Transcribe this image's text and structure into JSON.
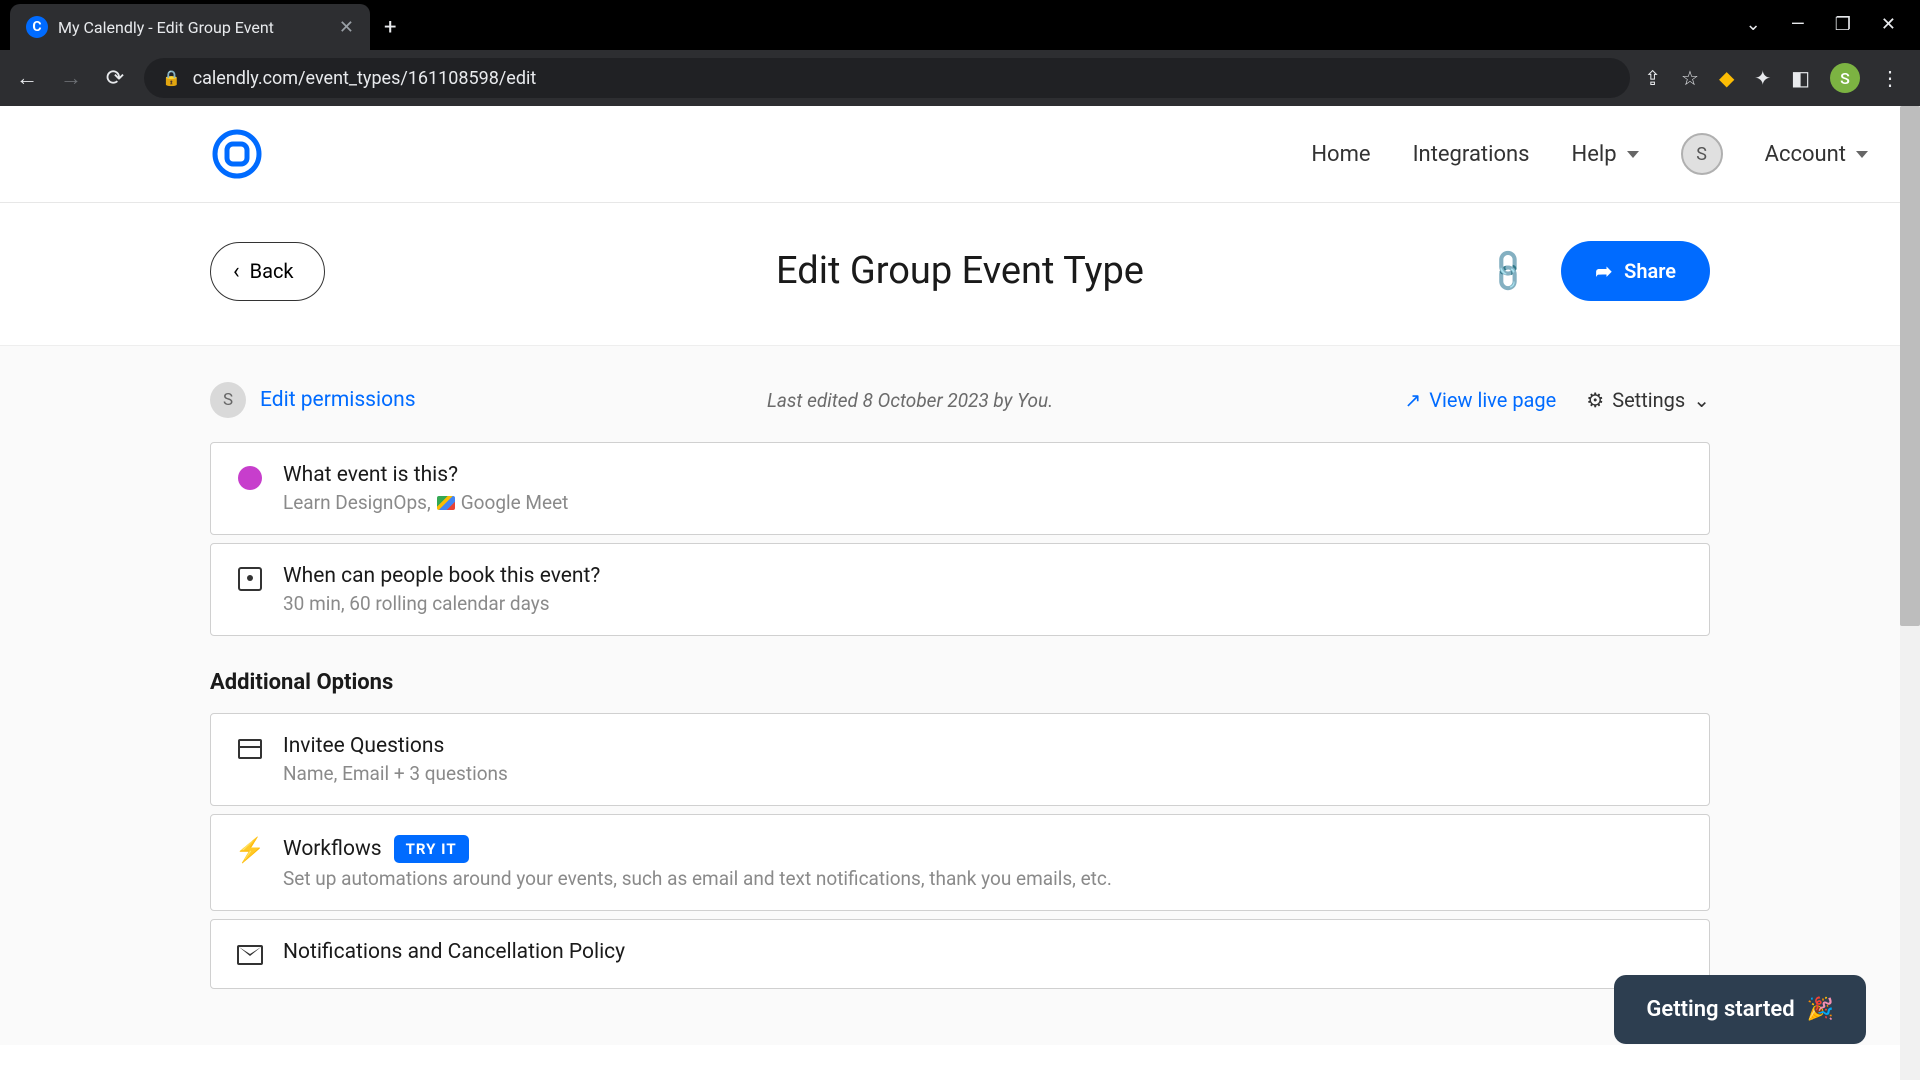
{
  "browser": {
    "tab_title": "My Calendly - Edit Group Event",
    "url": "calendly.com/event_types/161108598/edit",
    "profile_initial": "S"
  },
  "nav": {
    "home": "Home",
    "integrations": "Integrations",
    "help": "Help",
    "account": "Account",
    "avatar_initial": "S"
  },
  "header": {
    "back": "Back",
    "title": "Edit Group Event Type",
    "share": "Share"
  },
  "meta": {
    "avatar_initial": "S",
    "permissions": "Edit permissions",
    "last_edited": "Last edited 8 October 2023 by You.",
    "view_live": "View live page",
    "settings": "Settings"
  },
  "cards": {
    "what": {
      "title": "What event is this?",
      "sub_a": "Learn DesignOps,",
      "sub_b": "Google Meet"
    },
    "when": {
      "title": "When can people book this event?",
      "sub": "30 min, 60 rolling calendar days"
    }
  },
  "additional": {
    "heading": "Additional Options",
    "invitee": {
      "title": "Invitee Questions",
      "sub": "Name, Email + 3 questions"
    },
    "workflows": {
      "title": "Workflows",
      "badge": "TRY IT",
      "sub": "Set up automations around your events, such as email and text notifications, thank you emails, etc."
    },
    "notifications": {
      "title": "Notifications and Cancellation Policy"
    }
  },
  "widget": {
    "getting_started": "Getting started",
    "emoji": "🎉"
  }
}
